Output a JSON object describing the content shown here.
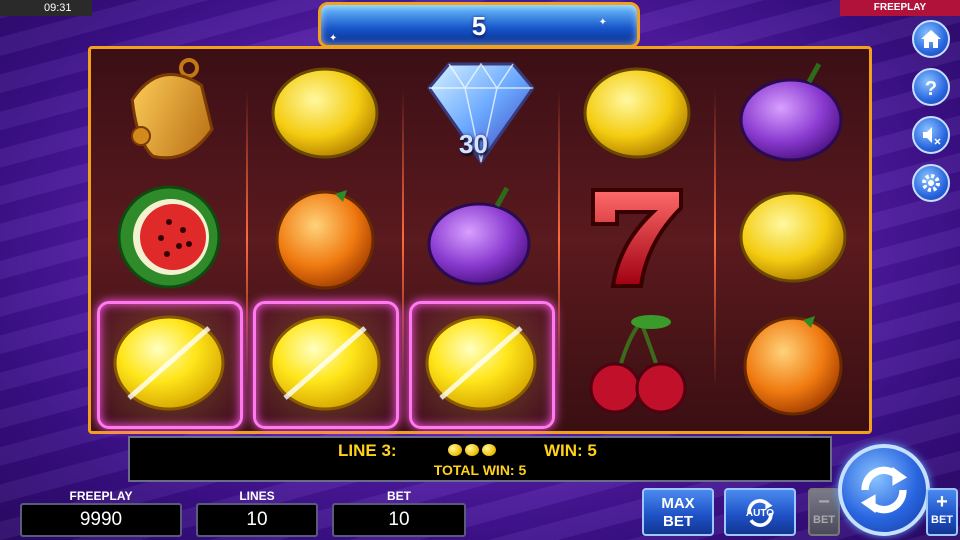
{
  "status": {
    "clock": "09:31",
    "mode": "FREEPLAY"
  },
  "win_display": {
    "value": "5"
  },
  "reels": {
    "columns": [
      [
        "bell",
        "watermelon",
        "lemon"
      ],
      [
        "lemon",
        "orange",
        "lemon"
      ],
      [
        "diamond",
        "plum",
        "lemon"
      ],
      [
        "lemon",
        "seven",
        "cherries"
      ],
      [
        "plum",
        "lemon",
        "orange"
      ]
    ],
    "diamond_value": "30",
    "winning_cells": [
      "reel-1-row-3",
      "reel-2-row-3",
      "reel-3-row-3"
    ]
  },
  "info": {
    "line_label": "LINE 3:",
    "line_win": "WIN: 5",
    "total_win": "TOTAL WIN: 5"
  },
  "bottom": {
    "freeplay_label": "FREEPLAY",
    "freeplay_value": "9990",
    "lines_label": "LINES",
    "lines_value": "10",
    "bet_label": "BET",
    "bet_value": "10",
    "max_bet_label": "MAX BET",
    "max_label": "MAX",
    "bet_word": "BET",
    "auto_label": "AUTO",
    "bet_minus_label": "BET",
    "bet_plus_label": "BET"
  },
  "side_buttons": [
    "home-icon",
    "help-icon",
    "sound-off-icon",
    "settings-icon"
  ],
  "colors": {
    "accent": "#f2a21a",
    "text_yellow": "#ffd21a",
    "win_frame": "#ff7af0"
  }
}
